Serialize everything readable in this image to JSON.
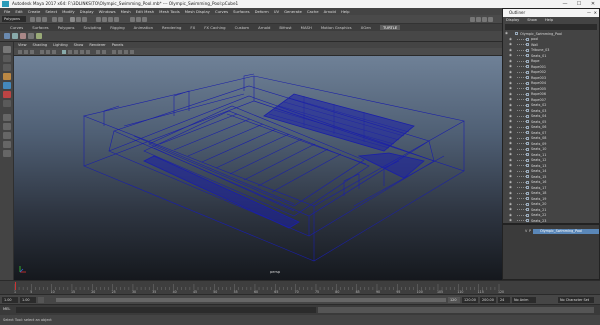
{
  "window": {
    "title": "Autodesk Maya 2017 x64: F:\\3DLINKS\\TO\\Olympic_Swimming_Pool.mb*  ---  Olympic_Swimming_Pool:pCube1",
    "minimize": "—",
    "maximize": "☐",
    "close": "✕"
  },
  "menubar": [
    "File",
    "Edit",
    "Create",
    "Select",
    "Modify",
    "Display",
    "Windows",
    "Mesh",
    "Edit Mesh",
    "Mesh Tools",
    "Mesh Display",
    "Curves",
    "Surfaces",
    "Deform",
    "UV",
    "Generate",
    "Cache",
    "Arnold",
    "Help"
  ],
  "status_line": {
    "mode": "Polygons"
  },
  "shelf_tabs": [
    "Curves",
    "Surfaces",
    "Polygons",
    "Sculpting",
    "Rigging",
    "Animation",
    "Rendering",
    "FX",
    "FX Caching",
    "Custom",
    "Arnold",
    "Bifrost",
    "MASH",
    "Motion Graphics",
    "XGen",
    "TURTLE"
  ],
  "shelf_active": "TURTLE",
  "panel_menu": [
    "View",
    "Shading",
    "Lighting",
    "Show",
    "Renderer",
    "Panels"
  ],
  "viewport": {
    "camera_label": "persp",
    "wire_color": "#1a1fa8"
  },
  "outliner": {
    "title": "Outliner",
    "menu": [
      "Display",
      "Show",
      "Help"
    ],
    "items": [
      "Olympic_Swimming_Pool",
      "pool",
      "Wall",
      "Tribune_03",
      "Seats_01",
      "Rope",
      "Rope001",
      "Rope002",
      "Rope003",
      "Rope004",
      "Rope005",
      "Rope006",
      "Rope007",
      "Seats_02",
      "Seats_03",
      "Seats_04",
      "Seats_05",
      "Seats_06",
      "Seats_07",
      "Seats_08",
      "Seats_09",
      "Seats_10",
      "Seats_11",
      "Seats_12",
      "Seats_13",
      "Seats_14",
      "Seats_15",
      "Seats_16",
      "Seats_17",
      "Seats_18",
      "Seats_19",
      "Seats_20",
      "Seats_21",
      "Seats_22",
      "Seats_23",
      "Seats_24"
    ]
  },
  "layer": {
    "name": "Olympic_Swimming_Pool",
    "visible": "V",
    "playback": "P"
  },
  "time_slider": {
    "ticks": [
      "1",
      "5",
      "10",
      "15",
      "20",
      "25",
      "30",
      "35",
      "40",
      "45",
      "50",
      "55",
      "60",
      "65",
      "70",
      "75",
      "80",
      "85",
      "90",
      "95",
      "100",
      "105",
      "110",
      "115",
      "120"
    ],
    "current": "1"
  },
  "range": {
    "start": "1.00",
    "start2": "1.00",
    "end": "120",
    "end2": "120.00",
    "end3": "200.00",
    "char_set": "No Character Set",
    "anim_layer": "No Anim Layer",
    "fps": "24 fps"
  },
  "command": {
    "lang": "MEL"
  },
  "help_line": "Select Tool: select an object"
}
